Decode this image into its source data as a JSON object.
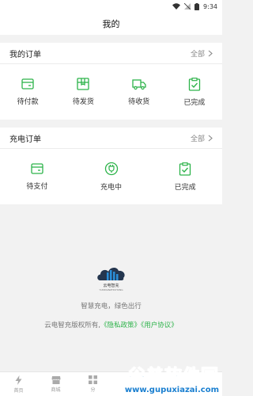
{
  "status": {
    "time": "9:34"
  },
  "header": {
    "title": "我的"
  },
  "orders": {
    "title": "我的订单",
    "more": "全部",
    "items": [
      {
        "label": "待付款",
        "icon": "wallet-icon"
      },
      {
        "label": "待发货",
        "icon": "package-icon"
      },
      {
        "label": "待收货",
        "icon": "truck-icon"
      },
      {
        "label": "已完成",
        "icon": "clipboard-check-icon"
      }
    ]
  },
  "charging": {
    "title": "充电订单",
    "more": "全部",
    "items": [
      {
        "label": "待支付",
        "icon": "wallet-icon"
      },
      {
        "label": "充电中",
        "icon": "plug-icon"
      },
      {
        "label": "已完成",
        "icon": "clipboard-check-icon"
      }
    ]
  },
  "brand": {
    "logo_text": "云电智充",
    "logo_sub": "YUNDIANZHICHONG",
    "slogan": "智慧充电，绿色出行",
    "copyright_prefix": "云电智充版权所有,",
    "privacy": "《隐私政策》",
    "agreement": "《用户协议》"
  },
  "tabbar": [
    {
      "label": "首页",
      "icon": "bolt-icon"
    },
    {
      "label": "商城",
      "icon": "shop-icon"
    },
    {
      "label": "分",
      "icon": "grid-icon"
    }
  ],
  "watermark": {
    "main": "谷普软件园",
    "url": "www.gupuxiazai.com"
  },
  "colors": {
    "accent": "#2db34a",
    "background": "#f2f2f2"
  }
}
